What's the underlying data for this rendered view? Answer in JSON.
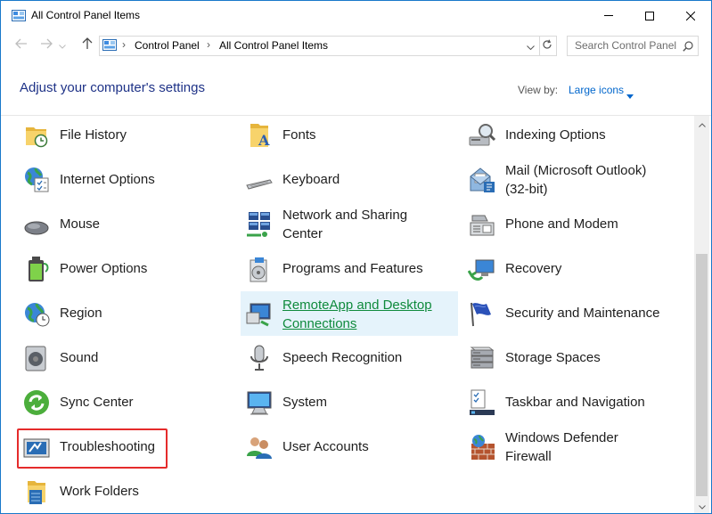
{
  "window": {
    "title": "All Control Panel Items",
    "controls": {
      "minimize_icon": "minimize-icon",
      "maximize_icon": "maximize-icon",
      "close_icon": "close-icon"
    }
  },
  "nav": {
    "back_icon": "back-arrow-icon",
    "forward_icon": "forward-arrow-icon",
    "recent_icon": "chevron-down-icon",
    "up_icon": "up-arrow-icon",
    "breadcrumb": [
      "Control Panel",
      "All Control Panel Items"
    ],
    "refresh_icon": "refresh-icon",
    "search_placeholder": "Search Control Panel",
    "search_icon": "search-icon"
  },
  "header": {
    "heading": "Adjust your computer's settings",
    "view_by_label": "View by:",
    "view_by_value": "Large icons"
  },
  "items": [
    {
      "label": "File History",
      "icon": "file-history-icon"
    },
    {
      "label": "Fonts",
      "icon": "fonts-icon"
    },
    {
      "label": "Indexing Options",
      "icon": "indexing-options-icon"
    },
    {
      "label": "Internet Options",
      "icon": "internet-options-icon"
    },
    {
      "label": "Keyboard",
      "icon": "keyboard-icon"
    },
    {
      "label": "Mail (Microsoft Outlook)\n(32-bit)",
      "icon": "mail-icon"
    },
    {
      "label": "Mouse",
      "icon": "mouse-icon"
    },
    {
      "label": "Network and Sharing\nCenter",
      "icon": "network-icon"
    },
    {
      "label": "Phone and Modem",
      "icon": "phone-modem-icon"
    },
    {
      "label": "Power Options",
      "icon": "power-options-icon"
    },
    {
      "label": "Programs and Features",
      "icon": "programs-features-icon"
    },
    {
      "label": "Recovery",
      "icon": "recovery-icon"
    },
    {
      "label": "Region",
      "icon": "region-icon"
    },
    {
      "label": "RemoteApp and Desktop\nConnections",
      "icon": "remoteapp-icon"
    },
    {
      "label": "Security and Maintenance",
      "icon": "security-flag-icon"
    },
    {
      "label": "Sound",
      "icon": "sound-icon"
    },
    {
      "label": "Speech Recognition",
      "icon": "microphone-icon"
    },
    {
      "label": "Storage Spaces",
      "icon": "storage-spaces-icon"
    },
    {
      "label": "Sync Center",
      "icon": "sync-center-icon"
    },
    {
      "label": "System",
      "icon": "system-icon"
    },
    {
      "label": "Taskbar and Navigation",
      "icon": "taskbar-icon"
    },
    {
      "label": "Troubleshooting",
      "icon": "troubleshooting-icon"
    },
    {
      "label": "User Accounts",
      "icon": "user-accounts-icon"
    },
    {
      "label": "Windows Defender\nFirewall",
      "icon": "firewall-icon"
    },
    {
      "label": "Work Folders",
      "icon": "work-folders-icon"
    }
  ],
  "colors": {
    "accent": "#1979ca",
    "heading": "#1e3287",
    "link": "#0066cc",
    "highlight_border": "#e52b2b",
    "hover_bg": "#e5f3fb"
  }
}
